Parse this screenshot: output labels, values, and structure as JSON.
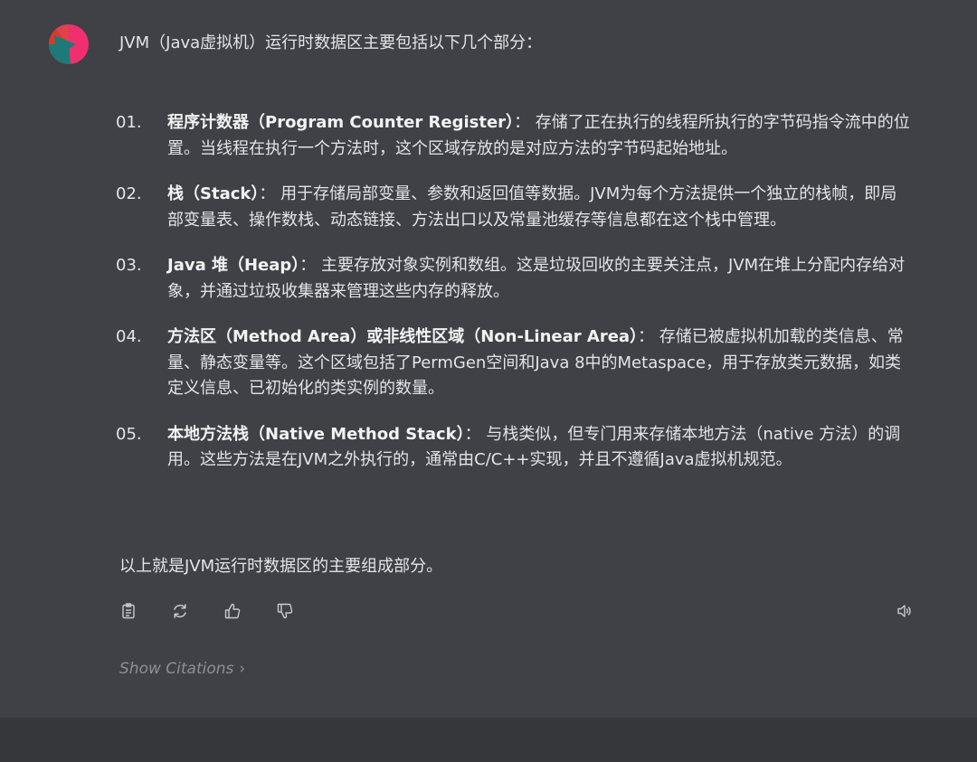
{
  "message": {
    "intro": "JVM（Java虚拟机）运行时数据区主要包括以下几个部分：",
    "items": [
      {
        "num": "01.",
        "title": "程序计数器（Program Counter Register）",
        "text": "： 存储了正在执行的线程所执行的字节码指令流中的位置。当线程在执行一个方法时，这个区域存放的是对应方法的字节码起始地址。"
      },
      {
        "num": "02.",
        "title": "栈（Stack）",
        "text": "： 用于存储局部变量、参数和返回值等数据。JVM为每个方法提供一个独立的栈帧，即局部变量表、操作数栈、动态链接、方法出口以及常量池缓存等信息都在这个栈中管理。"
      },
      {
        "num": "03.",
        "title": "Java 堆（Heap）",
        "text": "： 主要存放对象实例和数组。这是垃圾回收的主要关注点，JVM在堆上分配内存给对象，并通过垃圾收集器来管理这些内存的释放。"
      },
      {
        "num": "04.",
        "title": "方法区（Method Area）或非线性区域（Non-Linear Area）",
        "text": "： 存储已被虚拟机加载的类信息、常量、静态变量等。这个区域包括了PermGen空间和Java 8中的Metaspace，用于存放类元数据，如类定义信息、已初始化的类实例的数量。"
      },
      {
        "num": "05.",
        "title": "本地方法栈（Native Method Stack）",
        "text": "： 与栈类似，但专门用来存储本地方法（native 方法）的调用。这些方法是在JVM之外执行的，通常由C/C++实现，并且不遵循Java虚拟机规范。"
      }
    ],
    "conclusion": "以上就是JVM运行时数据区的主要组成部分。"
  },
  "actions": {
    "copy_icon": "clipboard-icon",
    "regenerate_icon": "refresh-icon",
    "like_icon": "thumbs-up-icon",
    "dislike_icon": "thumbs-down-icon",
    "speak_icon": "speaker-icon"
  },
  "citations": {
    "label": "Show Citations"
  },
  "colors": {
    "background": "#3f4146",
    "bottom_bar": "#35373b",
    "text": "#e3e4e6",
    "muted": "#8e9096",
    "avatar_pink": "#f0306e",
    "avatar_teal": "#1e7a78",
    "avatar_red": "#d83a2a"
  }
}
